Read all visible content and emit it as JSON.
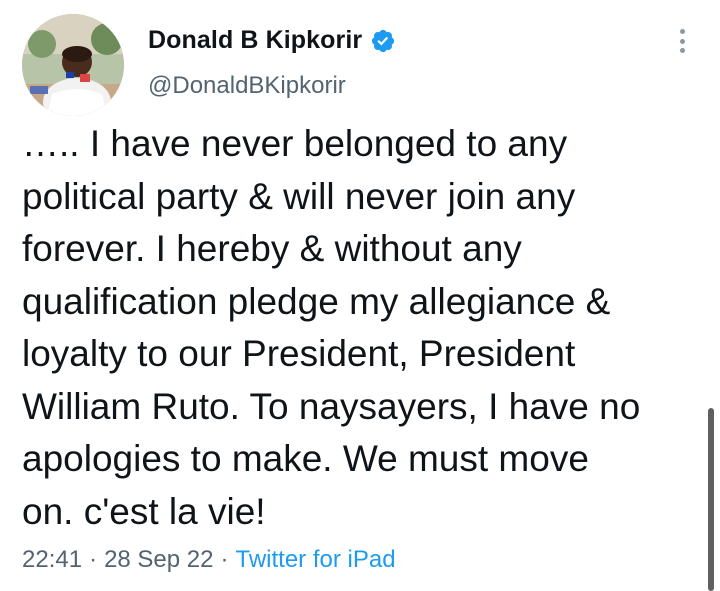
{
  "author": {
    "display_name": "Donald B Kipkorir",
    "handle": "@DonaldBKipkorir",
    "verified": true,
    "avatar_icon": "profile-photo"
  },
  "tweet": {
    "text": "….. I have never belonged to any\npolitical party & will never join any\nforever. I hereby & without any\nqualification pledge my allegiance &\nloyalty to our President, President\nWilliam Ruto. To naysayers, I have no\napologies to make. We must move\non. c'est la vie!",
    "time": "22:41",
    "date": "28 Sep 22",
    "separator": "·",
    "source": "Twitter for iPad"
  },
  "colors": {
    "accent": "#1d9bf0",
    "secondary_text": "#536471",
    "primary_text": "#0f1419"
  },
  "icons": {
    "more": "more-vertical-icon",
    "verified": "verified-badge-icon"
  }
}
